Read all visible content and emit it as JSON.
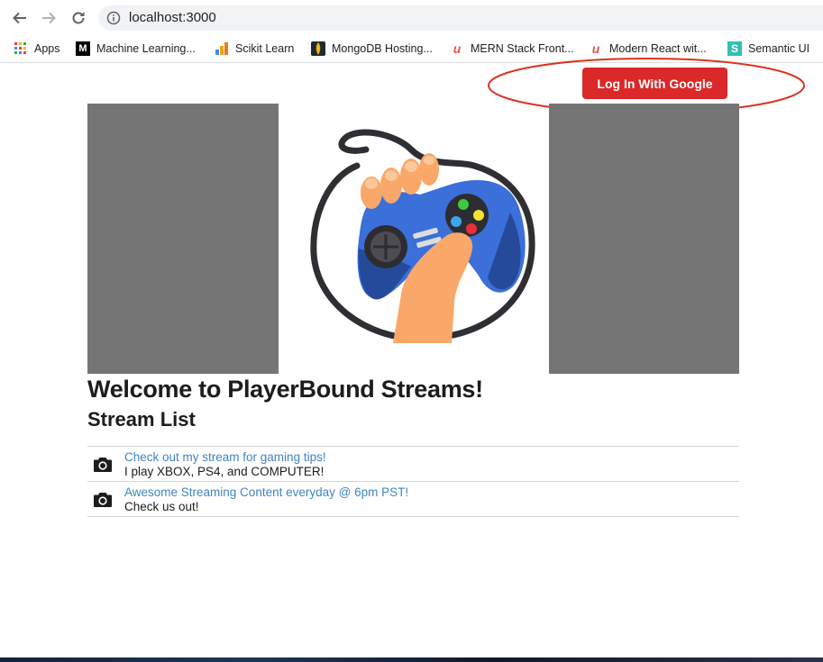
{
  "browser": {
    "url": "localhost:3000",
    "bookmarks": [
      {
        "label": "Apps",
        "icon": "apps-grid-icon"
      },
      {
        "label": "Machine Learning...",
        "icon": "medium-icon"
      },
      {
        "label": "Scikit Learn",
        "icon": "chart-icon"
      },
      {
        "label": "MongoDB Hosting...",
        "icon": "mongodb-icon"
      },
      {
        "label": "MERN Stack Front...",
        "icon": "udemy-icon"
      },
      {
        "label": "Modern React wit...",
        "icon": "udemy-icon"
      },
      {
        "label": "Semantic UI",
        "icon": "semantic-icon"
      }
    ]
  },
  "header": {
    "login_label": "Log In With Google"
  },
  "main": {
    "welcome": "Welcome to PlayerBound Streams!",
    "list_title": "Stream List",
    "streams": [
      {
        "title": "Check out my stream for gaming tips!",
        "description": "I play XBOX, PS4, and COMPUTER!"
      },
      {
        "title": "Awesome Streaming Content everyday @ 6pm PST!",
        "description": "Check us out!"
      }
    ]
  },
  "colors": {
    "login_button": "#db2828",
    "link": "#4183c4",
    "placeholder_gray": "#757575",
    "annotation_red": "#d9341f"
  }
}
